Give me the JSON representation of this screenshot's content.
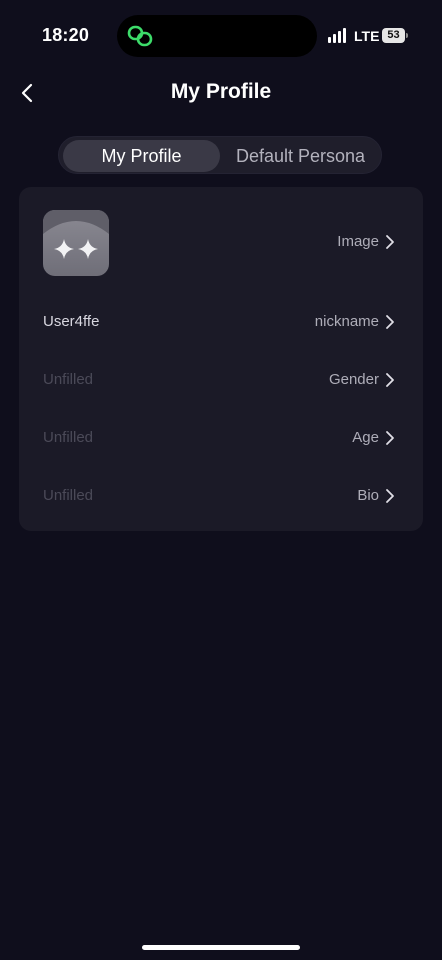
{
  "status_bar": {
    "time": "18:20",
    "network": "LTE",
    "battery": "53",
    "island_icon": "link-icon"
  },
  "header": {
    "title": "My Profile",
    "back_icon": "chevron-left-icon"
  },
  "tabs": [
    {
      "label": "My Profile",
      "active": true
    },
    {
      "label": "Default Persona",
      "active": false
    }
  ],
  "profile": {
    "avatar_icon": "sparkle-icon",
    "rows": [
      {
        "key": "image",
        "label": "Image",
        "value": ""
      },
      {
        "key": "nickname",
        "label": "nickname",
        "value": "User4ffe"
      },
      {
        "key": "gender",
        "label": "Gender",
        "value": "Unfilled"
      },
      {
        "key": "age",
        "label": "Age",
        "value": "Unfilled"
      },
      {
        "key": "bio",
        "label": "Bio",
        "value": "Unfilled"
      }
    ]
  },
  "colors": {
    "background": "#0f0e1c",
    "card": "#1b1a27",
    "accent_green": "#3ddc6a",
    "placeholder_text": "#4b4a58"
  }
}
